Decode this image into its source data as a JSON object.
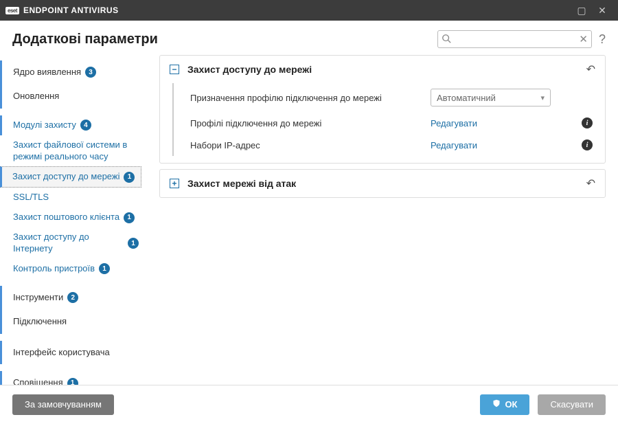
{
  "titlebar": {
    "brand_logo": "eset",
    "brand_text": "ENDPOINT ANTIVIRUS"
  },
  "header": {
    "title": "Додаткові параметри",
    "search_placeholder": ""
  },
  "sidebar": {
    "detection_core": {
      "label": "Ядро виявлення",
      "badge": "3"
    },
    "updates": {
      "label": "Оновлення"
    },
    "protection_modules": {
      "label": "Модулі захисту",
      "badge": "4"
    },
    "realtime_fs": {
      "label": "Захист файлової системи в режимі реального часу"
    },
    "network_access": {
      "label": "Захист доступу до мережі",
      "badge": "1"
    },
    "ssl_tls": {
      "label": "SSL/TLS"
    },
    "mail_client": {
      "label": "Захист поштового клієнта",
      "badge": "1"
    },
    "internet_access": {
      "label": "Захист доступу до Інтернету",
      "badge": "1"
    },
    "device_control": {
      "label": "Контроль пристроїв",
      "badge": "1"
    },
    "tools": {
      "label": "Інструменти",
      "badge": "2"
    },
    "connections": {
      "label": "Підключення"
    },
    "ui": {
      "label": "Інтерфейс користувача"
    },
    "notifications": {
      "label": "Сповіщення",
      "badge": "1"
    }
  },
  "panel_access": {
    "title": "Захист доступу до мережі",
    "row_profile_assign": "Призначення профілю підключення до мережі",
    "profile_assign_value": "Автоматичний",
    "row_profiles": "Профілі підключення до мережі",
    "row_ipsets": "Набори IP-адрес",
    "edit": "Редагувати"
  },
  "panel_attack": {
    "title": "Захист мережі від атак"
  },
  "footer": {
    "defaults": "За замовчуванням",
    "ok": "ОК",
    "cancel": "Скасувати"
  }
}
